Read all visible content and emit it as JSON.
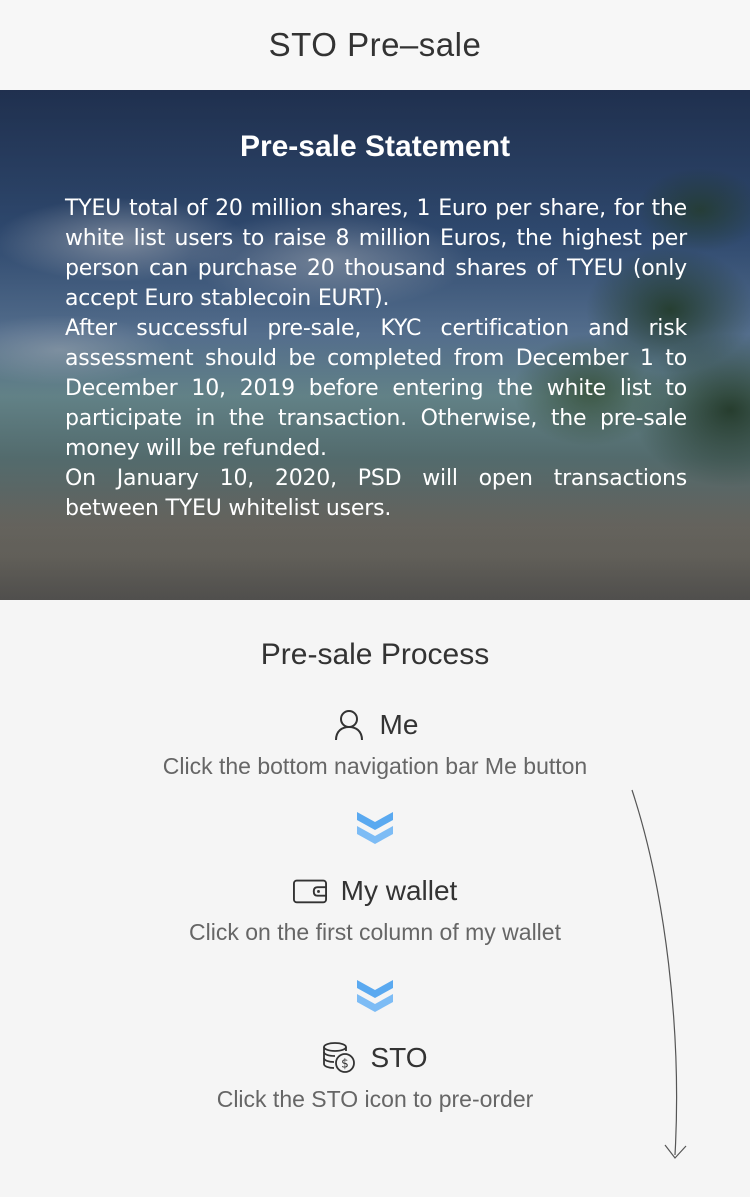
{
  "header": {
    "title": "STO Pre–sale"
  },
  "banner": {
    "title": "Pre-sale Statement",
    "paragraphs": [
      "TYEU total of 20 million shares, 1 Euro per share, for the white list users to raise 8 million Euros, the highest per person can purchase 20 thousand shares of TYEU (only accept Euro stablecoin EURT).",
      "After successful pre-sale, KYC certification and risk assessment should be completed from December 1 to December 10, 2019 before entering the white list to participate in the transaction. Otherwise, the pre-sale money will be refunded.",
      "On January 10, 2020, PSD will open transactions between TYEU whitelist users."
    ]
  },
  "process": {
    "title": "Pre-sale Process",
    "steps": [
      {
        "icon": "user-icon",
        "label": "Me",
        "description": "Click the bottom navigation bar Me button"
      },
      {
        "icon": "wallet-icon",
        "label": "My wallet",
        "description": "Click on the first column of my wallet"
      },
      {
        "icon": "coins-icon",
        "label": "STO",
        "description": "Click the STO icon to pre-order"
      }
    ]
  },
  "colors": {
    "chevron": "#5aa9f0",
    "background": "#f5f5f5"
  }
}
